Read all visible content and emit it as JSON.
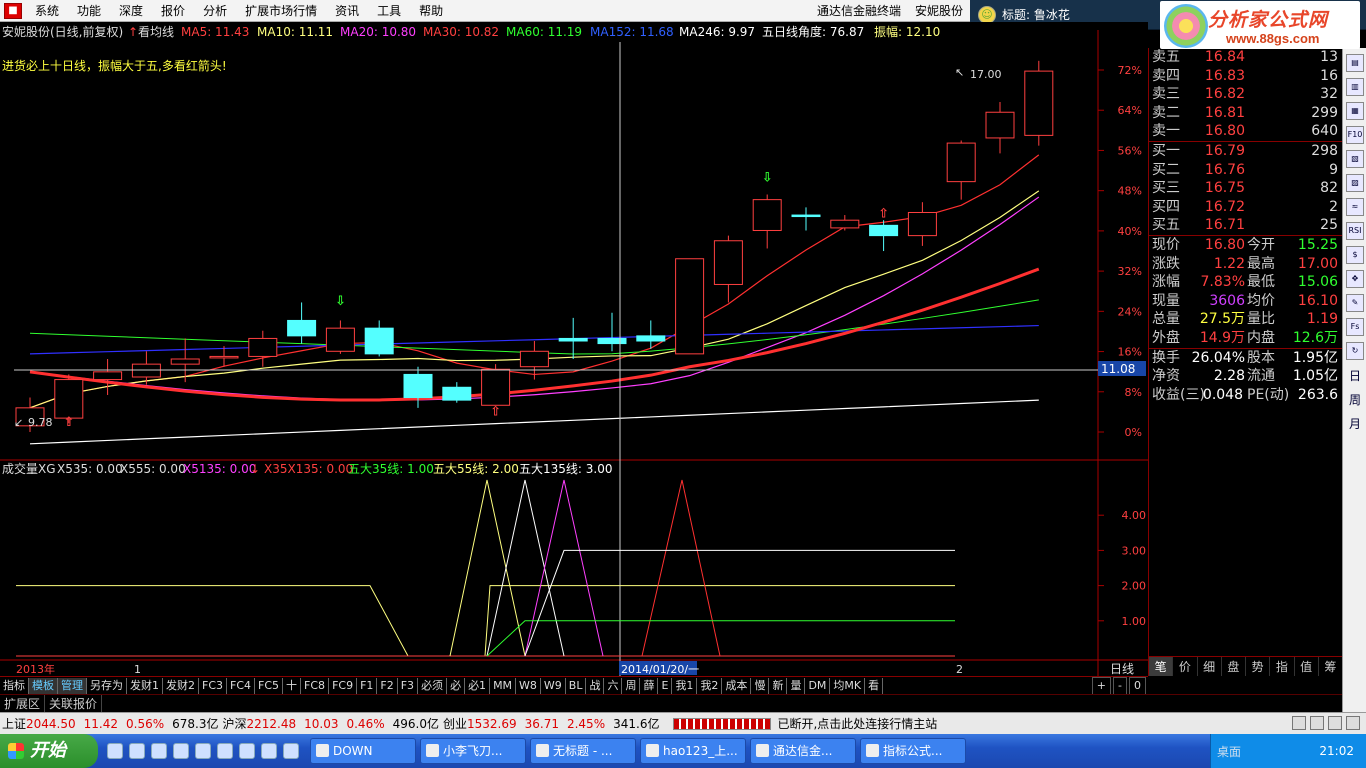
{
  "menubar": {
    "logo": "■",
    "items": [
      "系统",
      "功能",
      "深度",
      "报价",
      "分析",
      "扩展市场行情",
      "资讯",
      "工具",
      "帮助"
    ],
    "right_title": [
      "通达信金融终端",
      "安妮股份"
    ]
  },
  "popup": {
    "face": "☺",
    "title": "标题: 鲁冰花",
    "brand_cn": "分析家公式网",
    "brand_url": "www.88gs.com"
  },
  "chart": {
    "header_left": "安妮股份(日线,前复权)",
    "avg_toggle": "看均线",
    "ma5": "MA5: 11.43",
    "ma10": "MA10: 11.11",
    "ma20": "MA20: 10.80",
    "ma30": "MA30: 10.82",
    "ma60": "MA60: 11.19",
    "ma152": "MA152: 11.68",
    "ma246": "MA246: 9.97",
    "angle": "五日线角度: 76.87",
    "amplitude": "振幅: 12.10",
    "tip": "进货必上十日线，振幅大于五,多看红箭头!",
    "high_label": "17.00",
    "low_label": "9.78",
    "crosshair_price": "11.08",
    "pct_axis": [
      "72%",
      "64%",
      "56%",
      "48%",
      "40%",
      "32%",
      "24%",
      "16%",
      "8%",
      "0%"
    ],
    "candles": [
      {
        "o": 9.9,
        "h": 10.45,
        "l": 9.78,
        "c": 10.25,
        "up": true
      },
      {
        "o": 10.05,
        "h": 10.9,
        "l": 9.95,
        "c": 10.8,
        "up": true
      },
      {
        "o": 10.8,
        "h": 11.2,
        "l": 10.5,
        "c": 10.95,
        "up": true
      },
      {
        "o": 10.85,
        "h": 11.35,
        "l": 10.7,
        "c": 11.1,
        "up": true
      },
      {
        "o": 11.1,
        "h": 11.6,
        "l": 10.75,
        "c": 11.2,
        "up": true
      },
      {
        "o": 11.25,
        "h": 11.45,
        "l": 11.05,
        "c": 11.25,
        "up": true
      },
      {
        "o": 11.25,
        "h": 11.75,
        "l": 11.05,
        "c": 11.6,
        "up": true
      },
      {
        "o": 11.95,
        "h": 12.3,
        "l": 11.5,
        "c": 11.65,
        "up": false
      },
      {
        "o": 11.35,
        "h": 11.95,
        "l": 11.3,
        "c": 11.8,
        "up": true
      },
      {
        "o": 11.8,
        "h": 11.95,
        "l": 11.25,
        "c": 11.3,
        "up": false
      },
      {
        "o": 10.9,
        "h": 11.05,
        "l": 10.25,
        "c": 10.45,
        "up": false
      },
      {
        "o": 10.65,
        "h": 10.75,
        "l": 10.35,
        "c": 10.4,
        "up": false
      },
      {
        "o": 10.3,
        "h": 11.1,
        "l": 10.3,
        "c": 11.0,
        "up": true
      },
      {
        "o": 11.05,
        "h": 11.55,
        "l": 10.8,
        "c": 11.35,
        "up": true
      },
      {
        "o": 11.6,
        "h": 12.0,
        "l": 11.2,
        "c": 11.55,
        "up": false
      },
      {
        "o": 11.6,
        "h": 12.1,
        "l": 11.35,
        "c": 11.5,
        "up": false
      },
      {
        "o": 11.55,
        "h": 11.95,
        "l": 11.4,
        "c": 11.65,
        "up": false
      },
      {
        "o": 11.3,
        "h": 13.15,
        "l": 11.3,
        "c": 13.15,
        "up": true
      },
      {
        "o": 12.65,
        "h": 13.6,
        "l": 12.3,
        "c": 13.5,
        "up": true
      },
      {
        "o": 13.7,
        "h": 14.4,
        "l": 13.35,
        "c": 14.3,
        "up": true
      },
      {
        "o": 14.0,
        "h": 14.15,
        "l": 13.7,
        "c": 14.0,
        "up": false
      },
      {
        "o": 13.75,
        "h": 14.0,
        "l": 13.7,
        "c": 13.9,
        "up": true
      },
      {
        "o": 13.8,
        "h": 13.9,
        "l": 13.3,
        "c": 13.6,
        "up": false
      },
      {
        "o": 13.6,
        "h": 14.25,
        "l": 13.4,
        "c": 14.05,
        "up": true
      },
      {
        "o": 14.65,
        "h": 15.45,
        "l": 14.3,
        "c": 15.4,
        "up": true
      },
      {
        "o": 15.5,
        "h": 16.2,
        "l": 15.2,
        "c": 16.0,
        "up": true
      },
      {
        "o": 15.55,
        "h": 17.0,
        "l": 15.35,
        "c": 16.8,
        "up": true
      }
    ],
    "ma_colors": {
      "ma5": "#ff3030",
      "ma10": "#ffff80",
      "ma20": "#ff40ff",
      "ma30": "#30ff30",
      "ma60": "#ffffff",
      "ma152": "#3030ff",
      "ma246": "#ffffff"
    }
  },
  "indicator": {
    "name": "成交量XG",
    "x535": "X535: 0.00",
    "x555": "X555: 0.00",
    "x5135": "X5135: 0.00",
    "x35x135": "X35X135: 0.00",
    "w35": "五大35线: 1.00",
    "w55": "五大55线: 2.00",
    "w135": "五大135线: 3.00",
    "axis": [
      "4.00",
      "3.00",
      "2.00",
      "1.00"
    ]
  },
  "dates": {
    "left": "2013年",
    "mark1": "1",
    "cursor": "2014/01/20/一",
    "mark2": "2",
    "period": "日线"
  },
  "bottomtabs": [
    "指标",
    "模板",
    "管理",
    "另存为",
    "发财1",
    "发财2",
    "FC3",
    "FC4",
    "FC5",
    "十",
    "FC8",
    "FC9",
    "F1",
    "F2",
    "F3",
    "必须",
    "必",
    "必1",
    "MM",
    "W8",
    "W9",
    "BL",
    "战",
    "六",
    "周",
    "薛",
    "E",
    "我1",
    "我2",
    "成本",
    "慢",
    "新",
    "量",
    "DM",
    "均MK",
    "看"
  ],
  "bottomtabs_right": [
    "+",
    "-",
    "0"
  ],
  "extbar": [
    "扩展区",
    "关联报价"
  ],
  "quote": {
    "sells": [
      {
        "label": "卖五",
        "price": "16.84",
        "vol": "13"
      },
      {
        "label": "卖四",
        "price": "16.83",
        "vol": "16"
      },
      {
        "label": "卖三",
        "price": "16.82",
        "vol": "32"
      },
      {
        "label": "卖二",
        "price": "16.81",
        "vol": "299"
      },
      {
        "label": "卖一",
        "price": "16.80",
        "vol": "640"
      }
    ],
    "buys": [
      {
        "label": "买一",
        "price": "16.79",
        "vol": "298"
      },
      {
        "label": "买二",
        "price": "16.76",
        "vol": "9"
      },
      {
        "label": "买三",
        "price": "16.75",
        "vol": "82"
      },
      {
        "label": "买四",
        "price": "16.72",
        "vol": "2"
      },
      {
        "label": "买五",
        "price": "16.71",
        "vol": "25"
      }
    ],
    "stats": [
      {
        "l1": "现价",
        "v1": "16.80",
        "c1": "#ff4040",
        "l2": "今开",
        "v2": "15.25",
        "c2": "#30ff30"
      },
      {
        "l1": "涨跌",
        "v1": "1.22",
        "c1": "#ff4040",
        "l2": "最高",
        "v2": "17.00",
        "c2": "#ff4040"
      },
      {
        "l1": "涨幅",
        "v1": "7.83%",
        "c1": "#ff4040",
        "l2": "最低",
        "v2": "15.06",
        "c2": "#30ff30"
      },
      {
        "l1": "现量",
        "v1": "3606",
        "c1": "#d040ff",
        "l2": "均价",
        "v2": "16.10",
        "c2": "#ff4040"
      },
      {
        "l1": "总量",
        "v1": "27.5万",
        "c1": "#ffff40",
        "l2": "量比",
        "v2": "1.19",
        "c2": "#ff4040"
      },
      {
        "l1": "外盘",
        "v1": "14.9万",
        "c1": "#ff4040",
        "l2": "内盘",
        "v2": "12.6万",
        "c2": "#30ff30"
      },
      {
        "l1": "换手",
        "v1": "26.04%",
        "c1": "#ffffff",
        "l2": "股本",
        "v2": "1.95亿",
        "c2": "#ffffff"
      },
      {
        "l1": "净资",
        "v1": "2.28",
        "c1": "#ffffff",
        "l2": "流通",
        "v2": "1.05亿",
        "c2": "#ffffff"
      },
      {
        "l1": "收益(三)",
        "v1": "0.048",
        "c1": "#ffffff",
        "l2": "PE(动)",
        "v2": "263.6",
        "c2": "#ffffff"
      }
    ],
    "tabs": [
      "笔",
      "价",
      "细",
      "盘",
      "势",
      "指",
      "值",
      "筹"
    ]
  },
  "toolbar": [
    "F10",
    "RSI",
    "$",
    "Fs",
    "日",
    "周",
    "月"
  ],
  "statusbar": {
    "sh_label": "上证",
    "sh_val": "2044.50",
    "sh_chg": "11.42",
    "sh_pct": "0.56%",
    "sh_amt": "678.3亿",
    "hs_label": "沪深",
    "hs_val": "2212.48",
    "hs_chg": "10.03",
    "hs_pct": "0.46%",
    "hs_amt": "496.0亿",
    "cy_label": "创业",
    "cy_val": "1532.69",
    "cy_chg": "36.71",
    "cy_pct": "2.45%",
    "cy_amt": "341.6亿",
    "msg": "已断开,点击此处连接行情主站"
  },
  "taskbar": {
    "start": "开始",
    "tasks": [
      "DOWN",
      "小李飞刀...",
      "无标题 - ...",
      "hao123_上...",
      "通达信金...",
      "指标公式..."
    ],
    "desktop": "桌面",
    "clock": "21:02"
  }
}
